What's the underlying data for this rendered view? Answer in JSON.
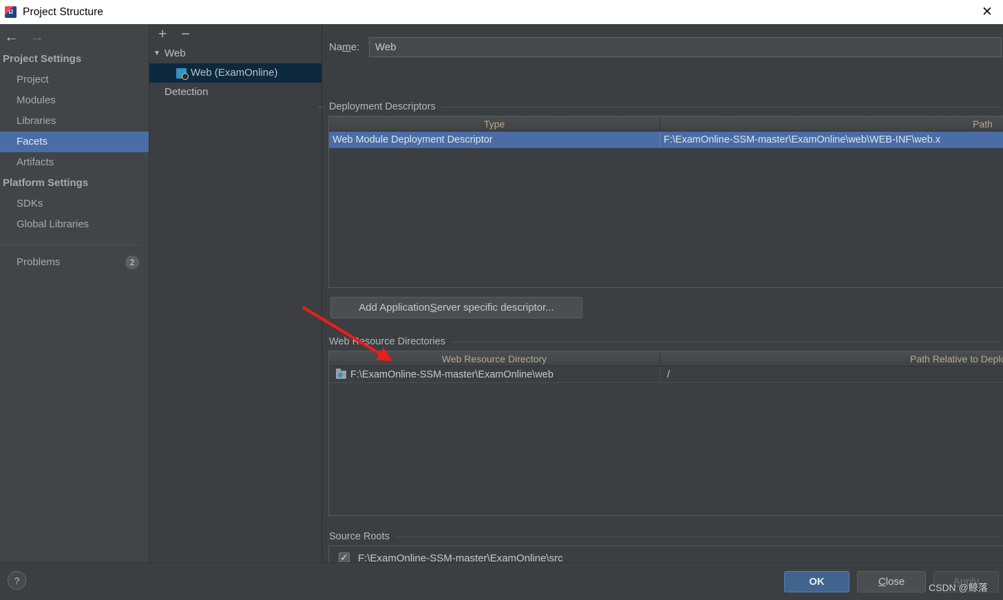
{
  "window": {
    "title": "Project Structure",
    "app_icon": "intellij-idea-icon",
    "close_icon": "✕"
  },
  "nav": {
    "back_icon": "←",
    "forward_icon": "→"
  },
  "sidebar": {
    "groups": [
      {
        "label": "Project Settings",
        "items": [
          {
            "label": "Project",
            "selected": false
          },
          {
            "label": "Modules",
            "selected": false
          },
          {
            "label": "Libraries",
            "selected": false
          },
          {
            "label": "Facets",
            "selected": true
          },
          {
            "label": "Artifacts",
            "selected": false
          }
        ]
      },
      {
        "label": "Platform Settings",
        "items": [
          {
            "label": "SDKs",
            "selected": false
          },
          {
            "label": "Global Libraries",
            "selected": false
          }
        ]
      }
    ],
    "problems": {
      "label": "Problems",
      "count": "2"
    },
    "selected_color": "#4a6da7"
  },
  "tree": {
    "toolbar": {
      "add_icon": "+",
      "remove_icon": "−"
    },
    "nodes": [
      {
        "label": "Web",
        "caret": "▼",
        "level": 0,
        "selected": false,
        "icon": null
      },
      {
        "label": "Web (ExamOnline)",
        "caret": "",
        "level": 1,
        "selected": true,
        "icon": "web-facet-icon"
      },
      {
        "label": "Detection",
        "caret": "",
        "level": 0,
        "selected": false,
        "icon": null
      }
    ],
    "selected_color": "#0d293e"
  },
  "content": {
    "name": {
      "label_before": "Na",
      "label_mnemonic": "m",
      "label_after": "e:",
      "value": "Web"
    },
    "deployment_descriptors": {
      "title": "Deployment Descriptors",
      "columns": [
        "Type",
        "Path"
      ],
      "rows": [
        {
          "type": "Web Module Deployment Descriptor",
          "path": "F:\\ExamOnline-SSM-master\\ExamOnline\\web\\WEB-INF\\web.x",
          "selected": true
        }
      ],
      "toolbar": [
        "+",
        "−",
        "pencil-icon"
      ]
    },
    "add_descriptor_button": {
      "before": "Add Application ",
      "mnemonic": "S",
      "after": "erver specific descriptor..."
    },
    "web_resource_directories": {
      "title": "Web Resource Directories",
      "columns": [
        "Web Resource Directory",
        "Path Relative to Deployment Root"
      ],
      "rows": [
        {
          "directory": "F:\\ExamOnline-SSM-master\\ExamOnline\\web",
          "relative_path": "/",
          "icon": "folder-icon"
        }
      ],
      "toolbar": [
        "+",
        "−",
        "pencil-icon",
        "?"
      ]
    },
    "source_roots": {
      "title": "Source Roots",
      "rows": [
        {
          "checked": true,
          "path": "F:\\ExamOnline-SSM-master\\ExamOnline\\src"
        }
      ]
    }
  },
  "footer": {
    "help_icon": "?",
    "ok": "OK",
    "close": {
      "before": "",
      "mnemonic": "C",
      "after": "lose"
    },
    "apply": {
      "before": "",
      "mnemonic": "A",
      "after": "pply"
    }
  },
  "watermark": "CSDN @鲸落"
}
